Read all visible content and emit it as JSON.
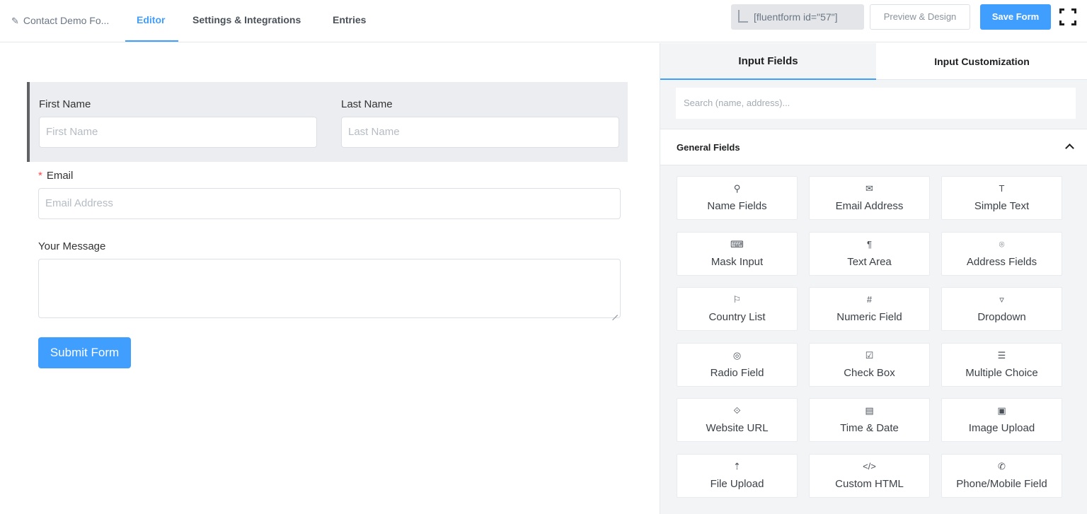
{
  "header": {
    "form_title": "Contact Demo Fo...",
    "tabs": [
      "Editor",
      "Settings & Integrations",
      "Entries"
    ],
    "active_tab": "Editor",
    "shortcode": "[fluentform id=\"57\"]",
    "preview_label": "Preview & Design",
    "save_label": "Save Form"
  },
  "form": {
    "first_name": {
      "label": "First Name",
      "placeholder": "First Name"
    },
    "last_name": {
      "label": "Last Name",
      "placeholder": "Last Name"
    },
    "email": {
      "required_mark": "*",
      "label": "Email",
      "placeholder": "Email Address"
    },
    "message": {
      "label": "Your Message"
    },
    "submit_label": "Submit Form"
  },
  "sidebar": {
    "tabs": [
      "Input Fields",
      "Input Customization"
    ],
    "active_tab": "Input Fields",
    "search_placeholder": "Search (name, address)...",
    "group_title": "General Fields",
    "fields": [
      {
        "label": "Name Fields",
        "icon": "person-icon",
        "glyph": "⚲"
      },
      {
        "label": "Email Address",
        "icon": "envelope-icon",
        "glyph": "✉"
      },
      {
        "label": "Simple Text",
        "icon": "text-cursor-icon",
        "glyph": "T"
      },
      {
        "label": "Mask Input",
        "icon": "keyboard-icon",
        "glyph": "⌨"
      },
      {
        "label": "Text Area",
        "icon": "paragraph-icon",
        "glyph": "¶"
      },
      {
        "label": "Address Fields",
        "icon": "location-pin-icon",
        "glyph": "⌾"
      },
      {
        "label": "Country List",
        "icon": "flag-icon",
        "glyph": "⚐"
      },
      {
        "label": "Numeric Field",
        "icon": "hash-icon",
        "glyph": "#"
      },
      {
        "label": "Dropdown",
        "icon": "dropdown-box-icon",
        "glyph": "▿"
      },
      {
        "label": "Radio Field",
        "icon": "radio-icon",
        "glyph": "◎"
      },
      {
        "label": "Check Box",
        "icon": "checkbox-icon",
        "glyph": "☑"
      },
      {
        "label": "Multiple Choice",
        "icon": "list-icon",
        "glyph": "☰"
      },
      {
        "label": "Website URL",
        "icon": "link-icon",
        "glyph": "⟐"
      },
      {
        "label": "Time & Date",
        "icon": "calendar-icon",
        "glyph": "▤"
      },
      {
        "label": "Image Upload",
        "icon": "image-icon",
        "glyph": "▣"
      },
      {
        "label": "File Upload",
        "icon": "upload-icon",
        "glyph": "⇡"
      },
      {
        "label": "Custom HTML",
        "icon": "code-icon",
        "glyph": "</>"
      },
      {
        "label": "Phone/Mobile Field",
        "icon": "phone-icon",
        "glyph": "✆"
      }
    ]
  },
  "colors": {
    "accent": "#409eff",
    "required": "#ff4949"
  }
}
